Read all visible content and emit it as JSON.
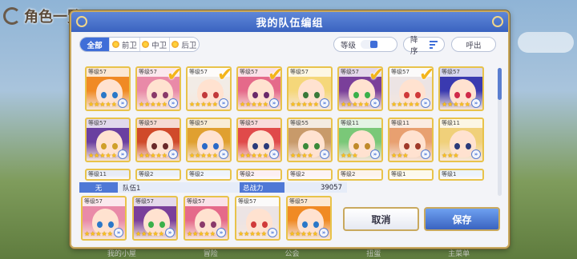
{
  "background": {
    "title": "角色一覧",
    "bottom_tabs": [
      "我的小屋",
      "冒险",
      "公会",
      "扭蛋",
      "主菜单"
    ]
  },
  "dialog": {
    "title": "我的队伍编组",
    "filters": [
      {
        "label": "全部",
        "active": true
      },
      {
        "label": "前卫",
        "active": false
      },
      {
        "label": "中卫",
        "active": false
      },
      {
        "label": "后卫",
        "active": false
      }
    ],
    "level_sort_label": "等级",
    "order_label": "降序",
    "call_label": "呼出"
  },
  "roster": {
    "rows": [
      [
        {
          "level": "等级57",
          "stars": 5,
          "selected": false,
          "hair": "#f08a24",
          "eye": "#2a78c8"
        },
        {
          "level": "等级57",
          "stars": 5,
          "selected": true,
          "hair": "#e98aa8",
          "eye": "#8a3a6a"
        },
        {
          "level": "等级57",
          "stars": 5,
          "selected": true,
          "hair": "#f2ece6",
          "eye": "#c23a3a"
        },
        {
          "level": "等级57",
          "stars": 5,
          "selected": true,
          "hair": "#e56a8a",
          "eye": "#6a2a6a"
        },
        {
          "level": "等级57",
          "stars": 5,
          "selected": false,
          "hair": "#f5d77a",
          "eye": "#3a7a3a"
        },
        {
          "level": "等级57",
          "stars": 5,
          "selected": true,
          "hair": "#7a3f9a",
          "eye": "#3ab04a"
        },
        {
          "level": "等级57",
          "stars": 5,
          "selected": true,
          "hair": "#ece4e4",
          "eye": "#d03a3a"
        },
        {
          "level": "等级57",
          "stars": 5,
          "selected": false,
          "hair": "#3a3ab0",
          "eye": "#d02a4a"
        }
      ],
      [
        {
          "level": "等级57",
          "stars": 5,
          "selected": false,
          "hair": "#6a3fa0",
          "eye": "#d0a02a"
        },
        {
          "level": "等级57",
          "stars": 5,
          "selected": false,
          "hair": "#d04a2a",
          "eye": "#6a2a2a"
        },
        {
          "level": "等级57",
          "stars": 5,
          "selected": false,
          "hair": "#e0a030",
          "eye": "#2a6ac8"
        },
        {
          "level": "等级57",
          "stars": 5,
          "selected": false,
          "hair": "#e04a4a",
          "eye": "#2a3a7a"
        },
        {
          "level": "等级55",
          "stars": 4,
          "selected": false,
          "hair": "#c89a6a",
          "eye": "#3a8a3a"
        },
        {
          "level": "等级11",
          "stars": 3,
          "selected": false,
          "hair": "#7ac878",
          "eye": "#c08a2a"
        },
        {
          "level": "等级11",
          "stars": 3,
          "selected": false,
          "hair": "#e8a070",
          "eye": "#a03a2a"
        },
        {
          "level": "等级11",
          "stars": 3,
          "selected": false,
          "hair": "#f0d07a",
          "eye": "#2a3a7a"
        }
      ],
      [
        {
          "level": "等级11",
          "stars": 0,
          "selected": false,
          "hair": "#8aa0d0",
          "eye": "#333"
        },
        {
          "level": "等级2",
          "stars": 0,
          "selected": false,
          "hair": "#a0b8e0",
          "eye": "#333"
        },
        {
          "level": "等级2",
          "stars": 0,
          "selected": false,
          "hair": "#b0c8f0",
          "eye": "#333"
        },
        {
          "level": "等级2",
          "stars": 0,
          "selected": false,
          "hair": "#f0b0c0",
          "eye": "#333"
        },
        {
          "level": "等级2",
          "stars": 0,
          "selected": false,
          "hair": "#f0c0d0",
          "eye": "#333"
        },
        {
          "level": "等级2",
          "stars": 0,
          "selected": false,
          "hair": "#f0c0a0",
          "eye": "#333"
        },
        {
          "level": "等级1",
          "stars": 0,
          "selected": false,
          "hair": "#f0e0a0",
          "eye": "#333"
        },
        {
          "level": "等级1",
          "stars": 0,
          "selected": false,
          "hair": "#a0c0f0",
          "eye": "#333"
        }
      ]
    ]
  },
  "team": {
    "number_label": "无",
    "name": "队伍1",
    "power_label": "总战力",
    "power_value": "39057",
    "members": [
      {
        "level": "等级57",
        "stars": 5,
        "hair": "#e98aa8",
        "eye": "#2a78c8"
      },
      {
        "level": "等级57",
        "stars": 5,
        "hair": "#7a3f9a",
        "eye": "#3ab04a"
      },
      {
        "level": "等级57",
        "stars": 5,
        "hair": "#e56a8a",
        "eye": "#8a3a6a"
      },
      {
        "level": "等级57",
        "stars": 5,
        "hair": "#ece4e4",
        "eye": "#d03a3a"
      },
      {
        "level": "等级57",
        "stars": 5,
        "hair": "#f08a24",
        "eye": "#2a78c8"
      }
    ]
  },
  "buttons": {
    "cancel": "取消",
    "save": "保存"
  }
}
